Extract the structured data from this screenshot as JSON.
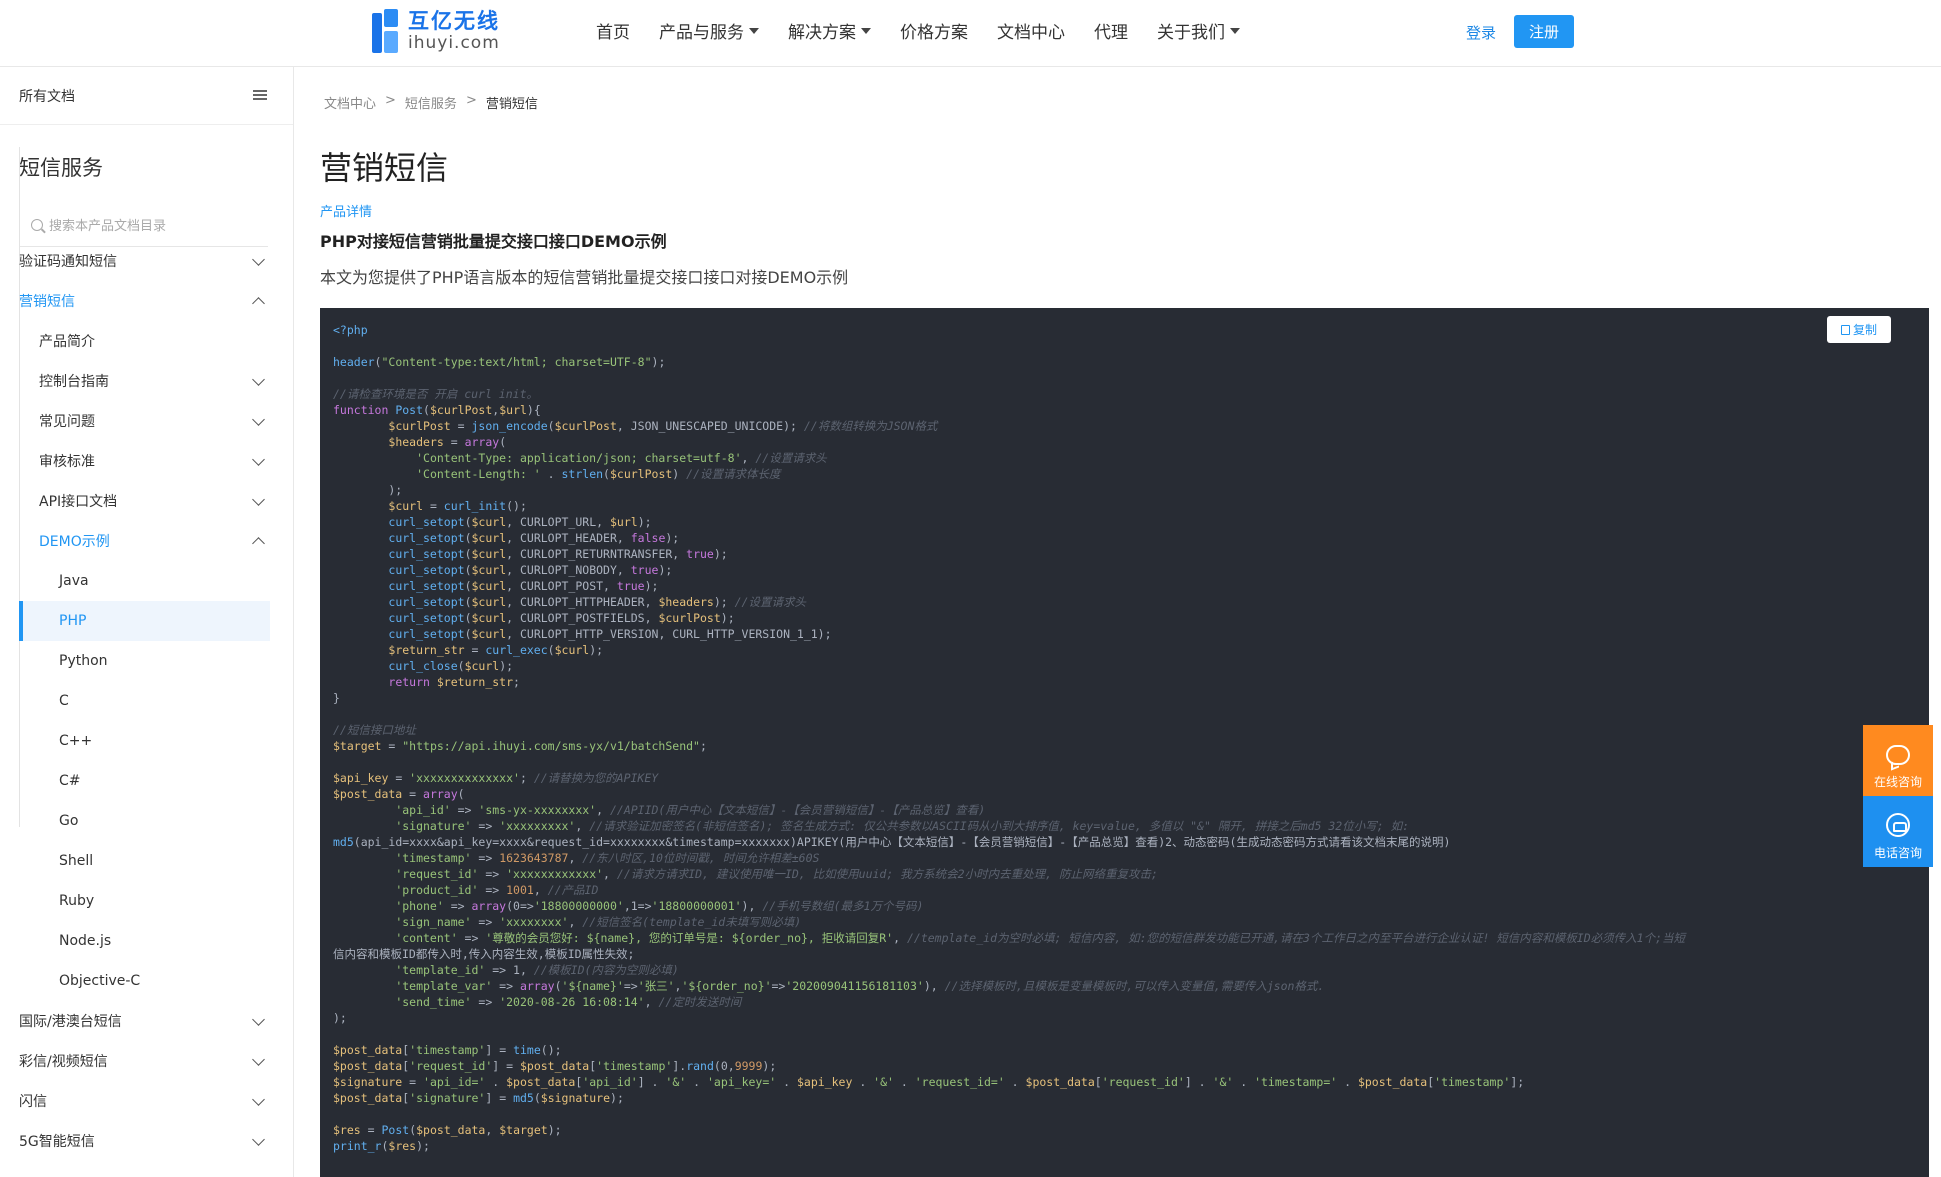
{
  "header": {
    "logo_cn": "互亿无线",
    "logo_en": "ihuyi.com",
    "nav": [
      {
        "label": "首页",
        "dropdown": false
      },
      {
        "label": "产品与服务",
        "dropdown": true
      },
      {
        "label": "解决方案",
        "dropdown": true
      },
      {
        "label": "价格方案",
        "dropdown": false
      },
      {
        "label": "文档中心",
        "dropdown": false
      },
      {
        "label": "代理",
        "dropdown": false
      },
      {
        "label": "关于我们",
        "dropdown": true
      }
    ],
    "login": "登录",
    "register": "注册"
  },
  "sidebar": {
    "all_docs": "所有文档",
    "title": "短信服务",
    "search_placeholder": "搜索本产品文档目录",
    "items": [
      {
        "label": "验证码通知短信",
        "level": 1,
        "chevron": "down"
      },
      {
        "label": "营销短信",
        "level": 1,
        "chevron": "up",
        "active": true
      },
      {
        "label": "产品简介",
        "level": 2
      },
      {
        "label": "控制台指南",
        "level": 2,
        "chevron": "down"
      },
      {
        "label": "常见问题",
        "level": 2,
        "chevron": "down"
      },
      {
        "label": "审核标准",
        "level": 2,
        "chevron": "down"
      },
      {
        "label": "API接口文档",
        "level": 2,
        "chevron": "down"
      },
      {
        "label": "DEMO示例",
        "level": 2,
        "chevron": "up",
        "active": true
      },
      {
        "label": "Java",
        "level": 3
      },
      {
        "label": "PHP",
        "level": 3,
        "selected": true
      },
      {
        "label": "Python",
        "level": 3
      },
      {
        "label": "C",
        "level": 3
      },
      {
        "label": "C++",
        "level": 3
      },
      {
        "label": "C#",
        "level": 3
      },
      {
        "label": "Go",
        "level": 3
      },
      {
        "label": "Shell",
        "level": 3
      },
      {
        "label": "Ruby",
        "level": 3
      },
      {
        "label": "Node.js",
        "level": 3
      },
      {
        "label": "Objective-C",
        "level": 3
      },
      {
        "label": "国际/港澳台短信",
        "level": 1,
        "chevron": "down"
      },
      {
        "label": "彩信/视频短信",
        "level": 1,
        "chevron": "down"
      },
      {
        "label": "闪信",
        "level": 1,
        "chevron": "down"
      },
      {
        "label": "5G智能短信",
        "level": 1,
        "chevron": "down"
      }
    ]
  },
  "main": {
    "breadcrumb": [
      "文档中心",
      "短信服务",
      "营销短信"
    ],
    "title": "营销短信",
    "detail_link": "产品详情",
    "subtitle": "PHP对接短信营销批量提交接口接口DEMO示例",
    "intro": "本文为您提供了PHP语言版本的短信营销批量提交接口接口对接DEMO示例",
    "copy_label": "复制",
    "code_lines": [
      "<?php",
      "",
      "header(\"Content-type:text/html; charset=UTF-8\");",
      "",
      "//请检查环境是否 开启 curl init。",
      "function Post($curlPost,$url){",
      "        $curlPost = json_encode($curlPost, JSON_UNESCAPED_UNICODE); //将数组转换为JSON格式",
      "        $headers = array(",
      "            'Content-Type: application/json; charset=utf-8', //设置请求头",
      "            'Content-Length: ' . strlen($curlPost) //设置请求体长度",
      "        );",
      "        $curl = curl_init();",
      "        curl_setopt($curl, CURLOPT_URL, $url);",
      "        curl_setopt($curl, CURLOPT_HEADER, false);",
      "        curl_setopt($curl, CURLOPT_RETURNTRANSFER, true);",
      "        curl_setopt($curl, CURLOPT_NOBODY, true);",
      "        curl_setopt($curl, CURLOPT_POST, true);",
      "        curl_setopt($curl, CURLOPT_HTTPHEADER, $headers); //设置请求头",
      "        curl_setopt($curl, CURLOPT_POSTFIELDS, $curlPost);",
      "        curl_setopt($curl, CURLOPT_HTTP_VERSION, CURL_HTTP_VERSION_1_1);",
      "        $return_str = curl_exec($curl);",
      "        curl_close($curl);",
      "        return $return_str;",
      "}",
      "",
      "//短信接口地址",
      "$target = \"https://api.ihuyi.com/sms-yx/v1/batchSend\";",
      "",
      "$api_key = 'xxxxxxxxxxxxxx'; //请替换为您的APIKEY",
      "$post_data = array(",
      "         'api_id' => 'sms-yx-xxxxxxxx', //APIID(用户中心【文本短信】-【会员营销短信】-【产品总览】查看)",
      "         'signature' => 'xxxxxxxxx', //请求验证加密签名(非短信签名); 签名生成方式: 仅公共参数以ASCII码从小到大排序值, key=value, 多值以 \"&\" 隔开, 拼接之后md5 32位小写; 如:",
      "md5(api_id=xxxx&api_key=xxxx&request_id=xxxxxxxx&timestamp=xxxxxxx)APIKEY(用户中心【文本短信】-【会员营销短信】-【产品总览】查看)2、动态密码(生成动态密码方式请看该文档末尾的说明)",
      "         'timestamp' => 1623643787, //东八时区,10位时间戳, 时间允许相差±60S",
      "         'request_id' => 'xxxxxxxxxxxx', //请求方请求ID, 建议使用唯一ID, 比如使用uuid; 我方系统会2小时内去重处理, 防止网络重复攻击;",
      "         'product_id' => 1001, //产品ID",
      "         'phone' => array(0=>'18800000000',1=>'18800000001'), //手机号数组(最多1万个号码)",
      "         'sign_name' => 'xxxxxxxx', //短信签名(template_id未填写则必填)",
      "         'content' => '尊敬的会员您好: ${name}, 您的订单号是: ${order_no}, 拒收请回复R', //template_id为空时必填; 短信内容, 如:您的短信群发功能已开通,请在3个工作日之内至平台进行企业认证! 短信内容和模板ID必须传入1个;当短",
      "信内容和模板ID都传入时,传入内容生效,模板ID属性失效;",
      "         'template_id' => 1, //模板ID(内容为空则必填)",
      "         'template_var' => array('${name}'=>'张三','${order_no}'=>'2020090411561811​03'), //选择模板时,且模板是变量模板时,可以传入变量值,需要传入json格式.",
      "         'send_time' => '2020-08-26 16:08:14', //定时发送时间",
      ");",
      "",
      "$post_data['timestamp'] = time();",
      "$post_data['request_id'] = $post_data['timestamp'].rand(0,9999);",
      "$signature = 'api_id=' . $post_data['api_id'] . '&' . 'api_key=' . $api_key . '&' . 'request_id=' . $post_data['request_id'] . '&' . 'timestamp=' . $post_data['timestamp'];",
      "$post_data['signature'] = md5($signature);",
      "",
      "$res = Post($post_data, $target);",
      "print_r($res);"
    ]
  },
  "float": {
    "online": "在线咨询",
    "phone": "电话咨询"
  },
  "colors": {
    "accent": "#2196f3",
    "code_bg": "#282c34",
    "float_online": "#ff8a1f",
    "float_phone": "#1e90f0"
  }
}
